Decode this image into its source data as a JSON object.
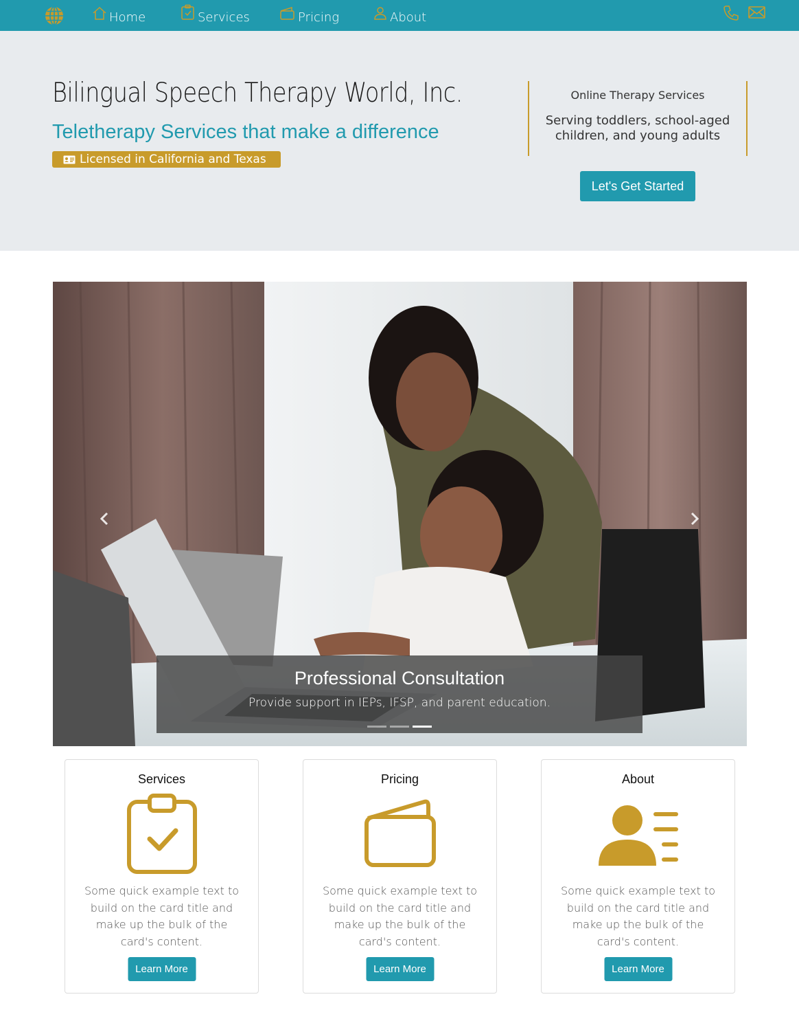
{
  "colors": {
    "brand_teal": "#219aae",
    "gold": "#c89b2b",
    "hero_bg": "#e8ebee"
  },
  "nav": {
    "logo_icon": "globe-icon",
    "items": [
      {
        "label": "Home",
        "icon": "home-icon"
      },
      {
        "label": "Services",
        "icon": "clipboard-check-icon"
      },
      {
        "label": "Pricing",
        "icon": "wallet-icon"
      },
      {
        "label": "About",
        "icon": "person-icon"
      }
    ],
    "right_icons": [
      "phone-icon",
      "mail-icon"
    ]
  },
  "hero": {
    "title": "Bilingual Speech Therapy World, Inc.",
    "tagline": "Teletherapy Services that make a difference",
    "license_badge": "Licensed in California and Texas",
    "side_title": "Online Therapy Services",
    "side_text": "Serving toddlers, school-aged children, and young adults",
    "cta_label": "Let's Get Started"
  },
  "carousel": {
    "caption_title": "Professional Consultation",
    "caption_text": "Provide support in IEPs, IFSP, and parent education.",
    "slide_count": 3,
    "active_slide": 3
  },
  "cards": [
    {
      "title": "Services",
      "icon": "clipboard-check-icon",
      "text": "Some quick example text to build on the card title and make up the bulk of the card's content.",
      "button": "Learn More"
    },
    {
      "title": "Pricing",
      "icon": "wallet-icon",
      "text": "Some quick example text to build on the card title and make up the bulk of the card's content.",
      "button": "Learn More"
    },
    {
      "title": "About",
      "icon": "person-card-icon",
      "text": "Some quick example text to build on the card title and make up the bulk of the card's content.",
      "button": "Learn More"
    }
  ]
}
